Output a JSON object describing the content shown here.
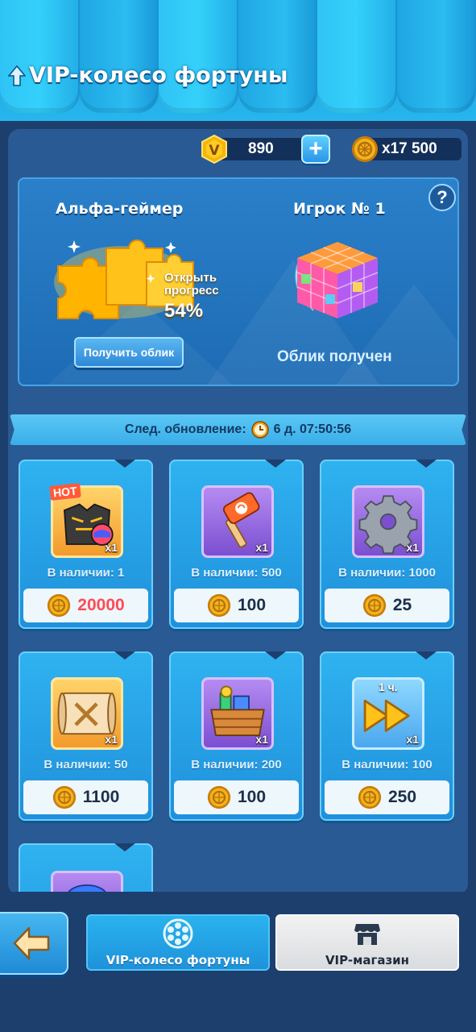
{
  "header": {
    "title": "VIP-колесо фортуны"
  },
  "currency": {
    "vip_points": "890",
    "coins": "x17 500"
  },
  "feature": {
    "left_title": "Альфа-геймер",
    "progress_label_line1": "Открыть",
    "progress_label_line2": "прогресс",
    "progress_percent": "54%",
    "progress_value": 0.54,
    "get_skin_button": "Получить облик",
    "right_title": "Игрок № 1",
    "skin_status": "Облик получен",
    "help": "?"
  },
  "timer": {
    "label": "След. обновление:",
    "value": "6 д. 07:50:56"
  },
  "shop_items": [
    {
      "badge": "HOT",
      "qty": "x1",
      "stock": "В наличии:  1",
      "price": "20000",
      "icon": "jacket-helmet-icon",
      "box": "orange",
      "price_color": "red"
    },
    {
      "qty": "x1",
      "stock": "В наличии:  500",
      "price": "100",
      "icon": "hammer-icon",
      "box": "purple"
    },
    {
      "qty": "x1",
      "stock": "В наличии:  1000",
      "price": "25",
      "icon": "gear-icon",
      "box": "purple"
    },
    {
      "qty": "x1",
      "stock": "В наличии:  50",
      "price": "1100",
      "icon": "blueprint-icon",
      "box": "orange"
    },
    {
      "qty": "x1",
      "stock": "В наличии:  200",
      "price": "100",
      "icon": "crate-icon",
      "box": "purple"
    },
    {
      "badge": "1 ч.",
      "qty": "x1",
      "stock": "В наличии:  100",
      "price": "250",
      "icon": "fast-forward-icon",
      "box": "blue"
    }
  ],
  "bottom_nav": {
    "back": "back-arrow-icon",
    "tab_wheel": "VIP-колесо фортуны",
    "tab_shop": "VIP-магазин"
  },
  "colors": {
    "background": "#1d3f6e",
    "accent_blue": "#2fb2f0",
    "price_red": "#ff4a55",
    "coin_gold": "#f2b31d"
  }
}
